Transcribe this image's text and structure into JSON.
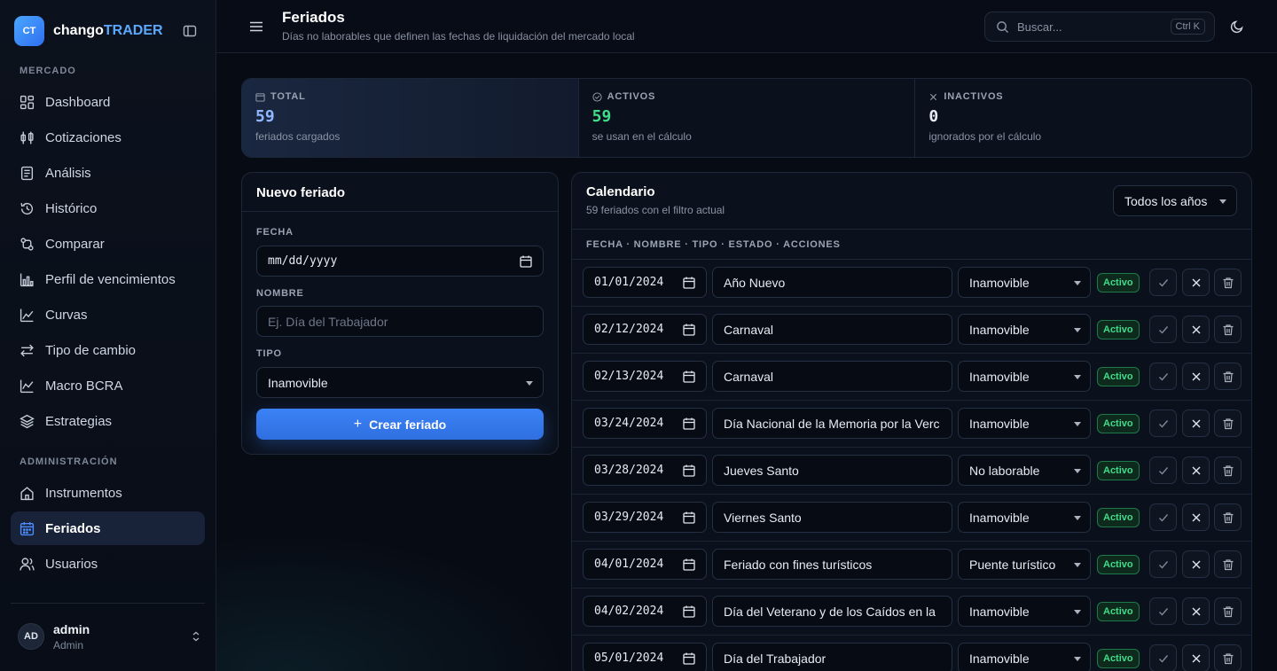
{
  "brand": {
    "logo": "CT",
    "name_a": "chango",
    "name_b": "TRADER"
  },
  "sidebar": {
    "section_market": "MERCADO",
    "section_admin": "ADMINISTRACIÓN",
    "items": [
      {
        "label": "Dashboard",
        "icon": "dashboard-icon"
      },
      {
        "label": "Cotizaciones",
        "icon": "quotes-icon"
      },
      {
        "label": "Análisis",
        "icon": "analysis-icon"
      },
      {
        "label": "Histórico",
        "icon": "history-icon"
      },
      {
        "label": "Comparar",
        "icon": "compare-icon"
      },
      {
        "label": "Perfil de vencimientos",
        "icon": "bar-chart-icon"
      },
      {
        "label": "Curvas",
        "icon": "curve-icon"
      },
      {
        "label": "Tipo de cambio",
        "icon": "exchange-icon"
      },
      {
        "label": "Macro BCRA",
        "icon": "line-chart-icon"
      },
      {
        "label": "Estrategias",
        "icon": "layers-icon"
      },
      {
        "label": "Instrumentos",
        "icon": "building-icon"
      },
      {
        "label": "Feriados",
        "icon": "calendar-icon"
      },
      {
        "label": "Usuarios",
        "icon": "users-icon"
      }
    ],
    "active": "Feriados"
  },
  "user": {
    "initials": "AD",
    "name": "admin",
    "role": "Admin"
  },
  "header": {
    "title": "Feriados",
    "subtitle": "Días no laborables que definen las fechas de liquidación del mercado local",
    "search_placeholder": "Buscar...",
    "shortcut": "Ctrl K"
  },
  "stats": [
    {
      "label": "TOTAL",
      "value": "59",
      "desc": "feriados cargados",
      "color": "#8fb8ff"
    },
    {
      "label": "ACTIVOS",
      "value": "59",
      "desc": "se usan en el cálculo",
      "color": "#3fdc8a"
    },
    {
      "label": "INACTIVOS",
      "value": "0",
      "desc": "ignorados por el cálculo",
      "color": "#e6ebf5"
    }
  ],
  "new_holiday": {
    "title": "Nuevo feriado",
    "date_label": "FECHA",
    "date_placeholder": "mm/dd/yyyy",
    "name_label": "NOMBRE",
    "name_placeholder": "Ej. Día del Trabajador",
    "type_label": "TIPO",
    "type_value": "Inamovible",
    "submit": "Crear feriado"
  },
  "calendar": {
    "title": "Calendario",
    "subtitle": "59 feriados con el filtro actual",
    "year_filter": "Todos los años",
    "columns": "FECHA · NOMBRE · TIPO · ESTADO · ACCIONES",
    "rows": [
      {
        "date": "01/01/2024",
        "name": "Año Nuevo",
        "type": "Inamovible",
        "status": "Activo"
      },
      {
        "date": "02/12/2024",
        "name": "Carnaval",
        "type": "Inamovible",
        "status": "Activo"
      },
      {
        "date": "02/13/2024",
        "name": "Carnaval",
        "type": "Inamovible",
        "status": "Activo"
      },
      {
        "date": "03/24/2024",
        "name": "Día Nacional de la Memoria por la Verc",
        "type": "Inamovible",
        "status": "Activo"
      },
      {
        "date": "03/28/2024",
        "name": "Jueves Santo",
        "type": "No laborable",
        "status": "Activo"
      },
      {
        "date": "03/29/2024",
        "name": "Viernes Santo",
        "type": "Inamovible",
        "status": "Activo"
      },
      {
        "date": "04/01/2024",
        "name": "Feriado con fines turísticos",
        "type": "Puente turístico",
        "status": "Activo"
      },
      {
        "date": "04/02/2024",
        "name": "Día del Veterano y de los Caídos en la",
        "type": "Inamovible",
        "status": "Activo"
      },
      {
        "date": "05/01/2024",
        "name": "Día del Trabajador",
        "type": "Inamovible",
        "status": "Activo"
      }
    ]
  }
}
